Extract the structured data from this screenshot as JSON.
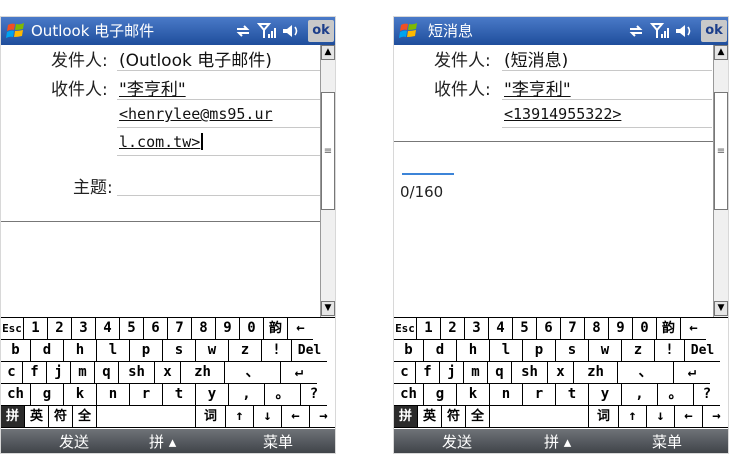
{
  "email": {
    "title": "Outlook 电子邮件",
    "ok_label": "ok",
    "from_label": "发件人:",
    "from_value": "(Outlook 电子邮件)",
    "to_label": "收件人:",
    "to_name": "\"李亨利\"",
    "to_addr1": "<henrylee@ms95.ur",
    "to_addr2": "l.com.tw>",
    "subject_label": "主题:"
  },
  "sms": {
    "title": "短消息",
    "ok_label": "ok",
    "from_label": "发件人:",
    "from_value": "(短消息)",
    "to_label": "收件人:",
    "to_name": "\"李亨利\"",
    "to_number": "<13914955322>",
    "char_count": "0/160"
  },
  "keyboard": {
    "rows": [
      [
        "Esc",
        "1",
        "2",
        "3",
        "4",
        "5",
        "6",
        "7",
        "8",
        "9",
        "0",
        "韵",
        "←"
      ],
      [
        "b",
        "d",
        "h",
        "l",
        "p",
        "s",
        "w",
        "z",
        "!",
        "Del"
      ],
      [
        "c",
        "f",
        "j",
        "m",
        "q",
        "sh",
        "x",
        "zh",
        "、",
        "↵"
      ],
      [
        "ch",
        "g",
        "k",
        "n",
        "r",
        "t",
        "y",
        ",",
        "。",
        "?"
      ],
      [
        "拼",
        "英",
        "符",
        "全",
        "",
        "词",
        "↑",
        "↓",
        "←",
        "→"
      ]
    ]
  },
  "softkeys": {
    "left": "发送",
    "center": "拼 ▴",
    "right": "菜单"
  },
  "colors": {
    "titlebar": "#1f4e9c",
    "softbar": "#4a4e53",
    "key_dark": "#2b2b2b"
  }
}
